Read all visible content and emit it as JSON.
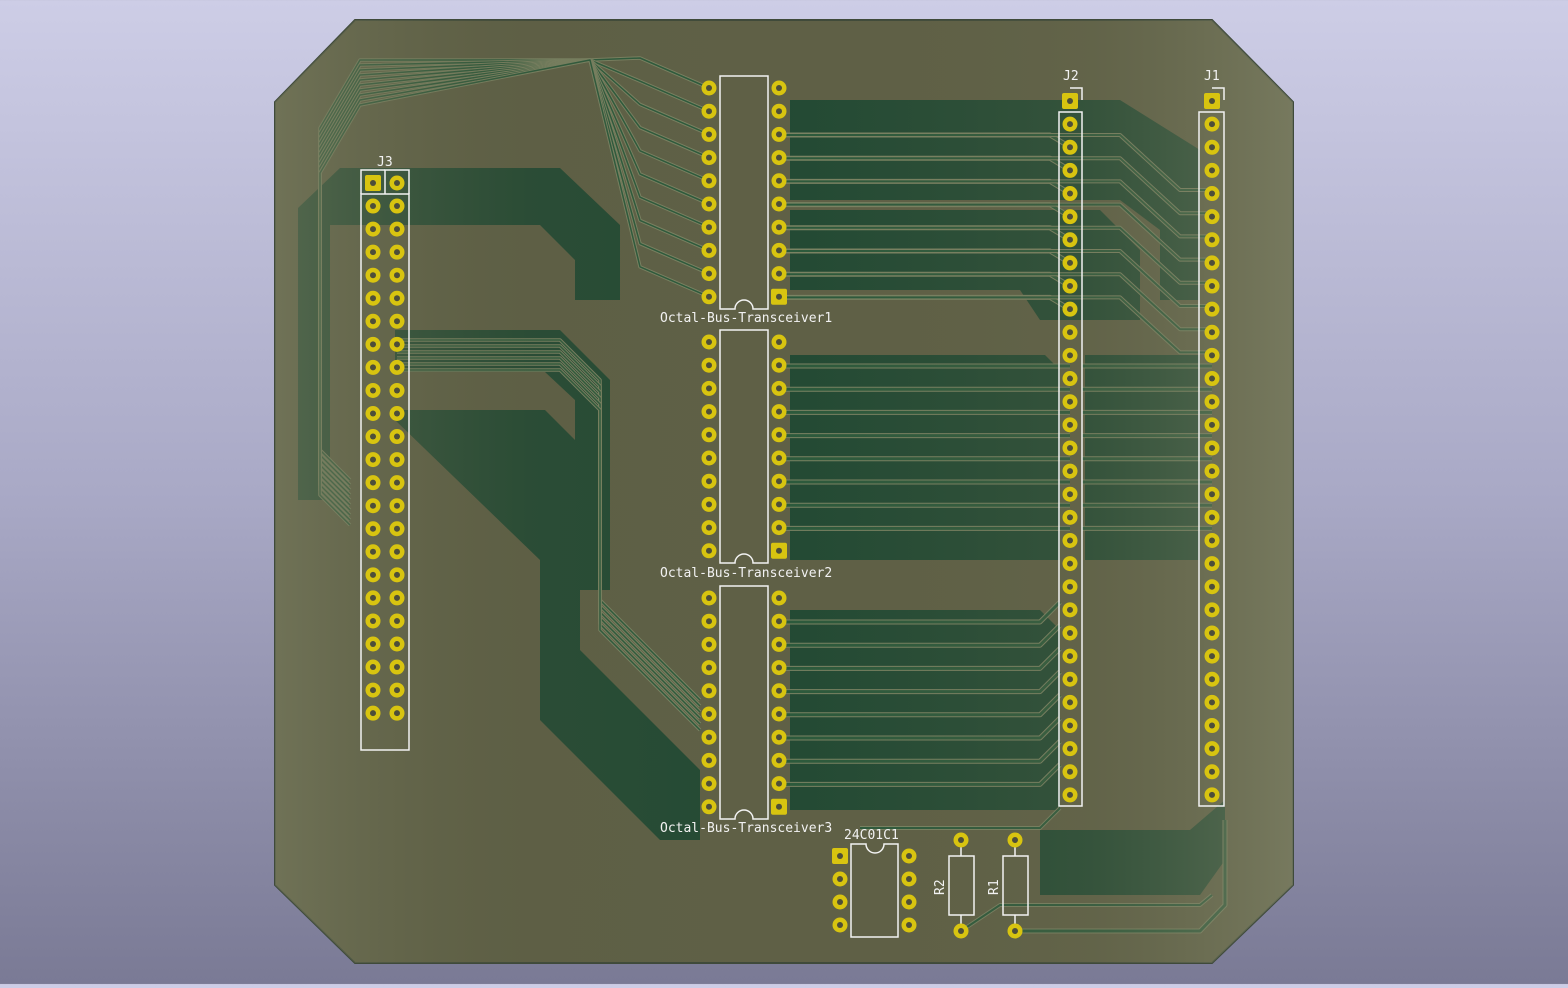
{
  "board": {
    "colors": {
      "background_top": "#cdcde6",
      "background_bottom": "#7a7a95",
      "substrate": "#5f6046",
      "copper_pour": "#234a34",
      "trace": "#2c5a3c",
      "trace_outline": "#7b8363",
      "pad": "#d8c410",
      "silkscreen": "#f2f2f2"
    },
    "components": {
      "j3": {
        "ref": "J3",
        "rows": 24,
        "cols": 2
      },
      "j2": {
        "ref": "J2",
        "rows": 31,
        "cols": 1
      },
      "j1": {
        "ref": "J1",
        "rows": 31,
        "cols": 1
      },
      "u1": {
        "ref": "Octal-Bus-Transceiver1",
        "pins_per_side": 10
      },
      "u2": {
        "ref": "Octal-Bus-Transceiver2",
        "pins_per_side": 10
      },
      "u3": {
        "ref": "Octal-Bus-Transceiver3",
        "pins_per_side": 10
      },
      "u4": {
        "ref": "24C01C1",
        "pins_per_side": 4
      },
      "r2": {
        "ref": "R2"
      },
      "r1": {
        "ref": "R1"
      }
    }
  }
}
